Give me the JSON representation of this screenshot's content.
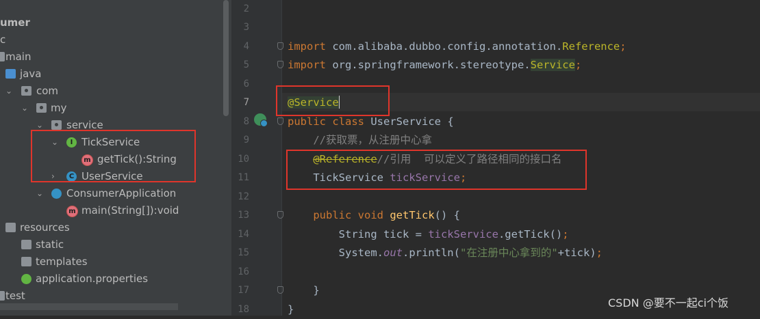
{
  "tree": {
    "nodes": [
      {
        "label": "umer",
        "indent": 0,
        "bold": true
      },
      {
        "label": "c",
        "indent": 0
      },
      {
        "label": "main",
        "indent": 1
      },
      {
        "label": "java",
        "indent": 2
      },
      {
        "label": "com",
        "indent": 3
      },
      {
        "label": "my",
        "indent": 4
      },
      {
        "label": "service",
        "indent": 5
      },
      {
        "label": "TickService",
        "indent": 6,
        "icon": "interface-icon"
      },
      {
        "label": "getTick():String",
        "indent": 7,
        "icon": "method-icon"
      },
      {
        "label": "UserService",
        "indent": 6,
        "icon": "class-icon"
      },
      {
        "label": "ConsumerApplication",
        "indent": 5,
        "icon": "spring-boot-class-icon"
      },
      {
        "label": "main(String[]):void",
        "indent": 6,
        "icon": "method-icon"
      },
      {
        "label": "resources",
        "indent": 1
      },
      {
        "label": "static",
        "indent": 2
      },
      {
        "label": "templates",
        "indent": 2
      },
      {
        "label": "application.properties",
        "indent": 2,
        "icon": "spring-properties-icon"
      },
      {
        "label": "test",
        "indent": 1
      }
    ],
    "icon_letters": {
      "interface": "I",
      "class": "C",
      "method": "m"
    }
  },
  "editor": {
    "line_numbers": [
      "2",
      "3",
      "4",
      "5",
      "6",
      "7",
      "8",
      "9",
      "10",
      "11",
      "12",
      "13",
      "14",
      "15",
      "16",
      "17",
      "18"
    ],
    "current_line": "7",
    "lines": {
      "l4_import": "import",
      "l4_pkg": " com.alibaba.dubbo.config.annotation.",
      "l4_cls": "Reference",
      "l4_semi": ";",
      "l5_import": "import",
      "l5_pkg": " org.springframework.stereotype.",
      "l5_cls": "Service",
      "l5_semi": ";",
      "l7_ann": "@Service",
      "l8_public": "public",
      "l8_class": " class",
      "l8_name": " UserService {",
      "l9_comment": "    //获取票，从注册中心拿",
      "l10_indent": "    ",
      "l10_ann": "@Reference",
      "l10_comment": "//引用  可以定义了路径相同的接口名",
      "l11_type": "    TickService ",
      "l11_field": "tickService",
      "l11_semi": ";",
      "l13_indent": "    ",
      "l13_public": "public",
      "l13_void": " void ",
      "l13_name": "getTick",
      "l13_rest": "() {",
      "l14_pre": "        String tick = ",
      "l14_field": "tickService",
      "l14_call": ".getTick()",
      "l14_semi": ";",
      "l15_pre": "        System.",
      "l15_out": "out",
      "l15_call": ".println(",
      "l15_str": "\"在注册中心拿到的\"",
      "l15_rest": "+tick)",
      "l15_semi": ";",
      "l17_brace": "    }",
      "l18_brace": "}"
    }
  },
  "watermark": "CSDN @要不一起ci个饭",
  "colors": {
    "highlight_box": "#e0352b",
    "keyword": "#cc7832",
    "annotation": "#bbb529",
    "field": "#9876aa",
    "method": "#ffc66d",
    "string": "#6a8759",
    "comment": "#808080"
  }
}
